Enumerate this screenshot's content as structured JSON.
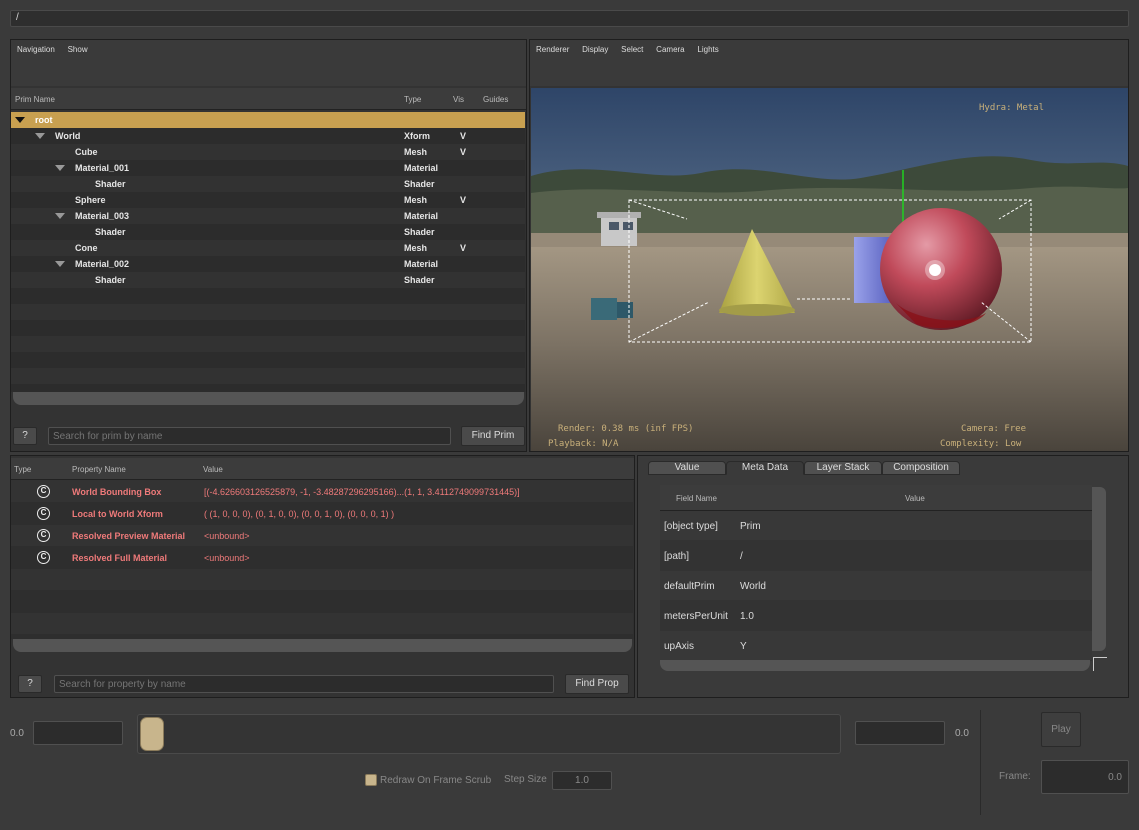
{
  "pathbar": {
    "value": "/"
  },
  "browser": {
    "menu": [
      "Navigation",
      "Show"
    ],
    "columns": {
      "name": "Prim Name",
      "type": "Type",
      "vis": "Vis",
      "guides": "Guides"
    },
    "rows": [
      {
        "name": "root",
        "type": "",
        "vis": "",
        "depth": 0,
        "expanded": true,
        "selected": true
      },
      {
        "name": "World",
        "type": "Xform",
        "vis": "V",
        "depth": 1,
        "expanded": true
      },
      {
        "name": "Cube",
        "type": "Mesh",
        "vis": "V",
        "depth": 2
      },
      {
        "name": "Material_001",
        "type": "Material",
        "vis": "",
        "depth": 2,
        "expanded": true
      },
      {
        "name": "Shader",
        "type": "Shader",
        "vis": "",
        "depth": 3
      },
      {
        "name": "Sphere",
        "type": "Mesh",
        "vis": "V",
        "depth": 2
      },
      {
        "name": "Material_003",
        "type": "Material",
        "vis": "",
        "depth": 2,
        "expanded": true
      },
      {
        "name": "Shader",
        "type": "Shader",
        "vis": "",
        "depth": 3
      },
      {
        "name": "Cone",
        "type": "Mesh",
        "vis": "V",
        "depth": 2
      },
      {
        "name": "Material_002",
        "type": "Material",
        "vis": "",
        "depth": 2,
        "expanded": true
      },
      {
        "name": "Shader",
        "type": "Shader",
        "vis": "",
        "depth": 3
      }
    ],
    "help_label": "?",
    "search_placeholder": "Search for prim by name",
    "find_label": "Find Prim",
    "selected_color": "#c8a050"
  },
  "viewport": {
    "menu": [
      "Renderer",
      "Display",
      "Select",
      "Camera",
      "Lights"
    ],
    "renderer_text": "Hydra: Metal",
    "render_text": "Render: 0.38 ms (inf FPS)",
    "playback_text": "Playback: N/A",
    "camera_text": "Camera: Free",
    "complexity_text": "Complexity: Low"
  },
  "properties": {
    "columns": {
      "type": "Type",
      "name": "Property Name",
      "value": "Value"
    },
    "rows": [
      {
        "icon": "C",
        "name": "World Bounding Box",
        "value": "[(-4.626603126525879, -1, -3.48287296295166)...(1, 1, 3.4112749099731445)]"
      },
      {
        "icon": "C",
        "name": "Local to World Xform",
        "value": "( (1, 0, 0, 0), (0, 1, 0, 0), (0, 0, 1, 0), (0, 0, 0, 1) )"
      },
      {
        "icon": "C",
        "name": "Resolved Preview Material",
        "value": "<unbound>"
      },
      {
        "icon": "C",
        "name": "Resolved Full Material",
        "value": "<unbound>"
      }
    ],
    "help_label": "?",
    "search_placeholder": "Search for property by name",
    "find_label": "Find Prop"
  },
  "metadata": {
    "tabs": [
      "Value",
      "Meta Data",
      "Layer Stack",
      "Composition"
    ],
    "active_tab": "Meta Data",
    "columns": {
      "field": "Field Name",
      "value": "Value"
    },
    "rows": [
      {
        "field": "[object type]",
        "value": "Prim"
      },
      {
        "field": "[path]",
        "value": "/"
      },
      {
        "field": "defaultPrim",
        "value": "World"
      },
      {
        "field": "metersPerUnit",
        "value": "1.0"
      },
      {
        "field": "upAxis",
        "value": "Y"
      }
    ]
  },
  "timeline": {
    "start_value": "0.0",
    "end_value": "0.0",
    "redraw_label": "Redraw On Frame Scrub",
    "step_label": "Step Size",
    "step_value": "1.0",
    "play_label": "Play",
    "frame_label": "Frame:",
    "frame_value": "0.0"
  }
}
